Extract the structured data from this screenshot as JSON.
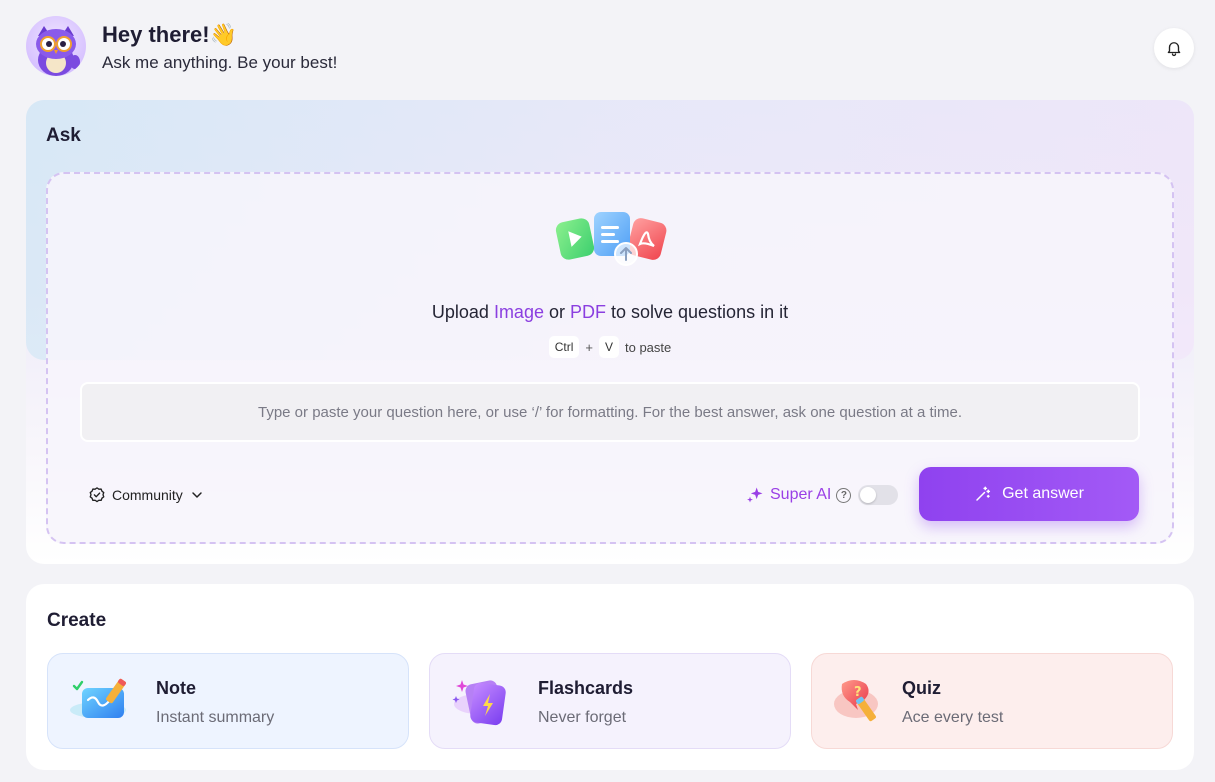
{
  "header": {
    "greeting": "Hey there!",
    "wave_emoji": "👋",
    "subtitle": "Ask me anything. Be your best!",
    "avatar_icon": "owl-mascot-icon",
    "notification_icon": "bell-icon"
  },
  "ask": {
    "title": "Ask",
    "upload": {
      "prefix": "Upload ",
      "image_link": "Image",
      "middle": " or ",
      "pdf_link": "PDF",
      "suffix": " to solve questions in it"
    },
    "paste_hint": {
      "key1": "Ctrl",
      "plus": "+",
      "key2": "V",
      "label": "to paste"
    },
    "input_placeholder": "Type or paste your question here, or use ‘/’ for formatting. For the best answer, ask one question at a time.",
    "community_label": "Community",
    "super_ai_label": "Super AI",
    "super_ai_help": "?",
    "super_ai_enabled": false,
    "get_answer_label": "Get answer"
  },
  "create": {
    "title": "Create",
    "tools": [
      {
        "name": "Note",
        "subtitle": "Instant summary",
        "icon": "note-icon"
      },
      {
        "name": "Flashcards",
        "subtitle": "Never forget",
        "icon": "flashcards-icon"
      },
      {
        "name": "Quiz",
        "subtitle": "Ace every test",
        "icon": "quiz-icon"
      }
    ]
  },
  "colors": {
    "accent": "#8f42ef",
    "link": "#8b3fe0",
    "background": "#f3f3f7"
  }
}
